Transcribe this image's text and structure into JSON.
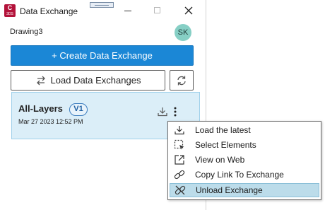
{
  "window": {
    "title": "Data Exchange",
    "app_icon_letter": "C",
    "app_icon_sub": "3DS"
  },
  "header": {
    "drawing_name": "Drawing3",
    "avatar_initials": "SK"
  },
  "buttons": {
    "create_label": "+ Create Data Exchange",
    "load_label": "Load Data Exchanges"
  },
  "exchange": {
    "name": "All-Layers",
    "version": "V1",
    "date": "Mar 27 2023 12:52 PM"
  },
  "context_menu": {
    "items": [
      {
        "label": "Load the latest",
        "icon": "download-icon"
      },
      {
        "label": "Select Elements",
        "icon": "select-elements-icon"
      },
      {
        "label": "View on Web",
        "icon": "external-link-icon"
      },
      {
        "label": "Copy Link To Exchange",
        "icon": "link-icon"
      },
      {
        "label": "Unload Exchange",
        "icon": "unlink-icon",
        "selected": true
      }
    ]
  },
  "colors": {
    "primary": "#1b87d6",
    "card_bg": "#dbeef8",
    "menu_selected": "#bcdcea",
    "app_icon": "#b3123a",
    "avatar": "#86cfc5"
  }
}
